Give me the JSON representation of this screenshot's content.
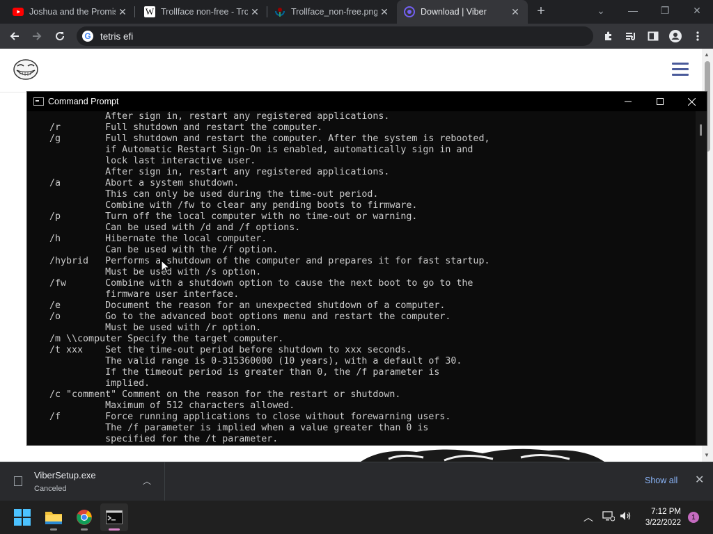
{
  "browser": {
    "tabs": [
      {
        "title": "Joshua and the Promis",
        "favicon": "youtube-icon",
        "active": false
      },
      {
        "title": "Trollface non-free - Tro",
        "favicon": "wikipedia-icon",
        "active": false
      },
      {
        "title": "Trollface_non-free.png",
        "favicon": "wikimedia-icon",
        "active": false
      },
      {
        "title": "Download | Viber",
        "favicon": "viber-icon",
        "active": true
      }
    ],
    "omnibox_text": "tetris efi",
    "colors": {
      "tabstrip": "#202124",
      "toolbar": "#35363a",
      "omnibox": "#202124"
    }
  },
  "cmd": {
    "title": "Command Prompt",
    "colors": {
      "background": "#0c0c0c",
      "text": "#cccccc"
    },
    "lines": [
      "              After sign in, restart any registered applications.",
      "    /r        Full shutdown and restart the computer.",
      "    /g        Full shutdown and restart the computer. After the system is rebooted,",
      "              if Automatic Restart Sign-On is enabled, automatically sign in and",
      "              lock last interactive user.",
      "              After sign in, restart any registered applications.",
      "    /a        Abort a system shutdown.",
      "              This can only be used during the time-out period.",
      "              Combine with /fw to clear any pending boots to firmware.",
      "    /p        Turn off the local computer with no time-out or warning.",
      "              Can be used with /d and /f options.",
      "    /h        Hibernate the local computer.",
      "              Can be used with the /f option.",
      "    /hybrid   Performs a shutdown of the computer and prepares it for fast startup.",
      "              Must be used with /s option.",
      "    /fw       Combine with a shutdown option to cause the next boot to go to the",
      "              firmware user interface.",
      "    /e        Document the reason for an unexpected shutdown of a computer.",
      "    /o        Go to the advanced boot options menu and restart the computer.",
      "              Must be used with /r option.",
      "    /m \\\\computer Specify the target computer.",
      "    /t xxx    Set the time-out period before shutdown to xxx seconds.",
      "              The valid range is 0-315360000 (10 years), with a default of 30.",
      "              If the timeout period is greater than 0, the /f parameter is",
      "              implied.",
      "    /c \"comment\" Comment on the reason for the restart or shutdown.",
      "              Maximum of 512 characters allowed.",
      "    /f        Force running applications to close without forewarning users.",
      "              The /f parameter is implied when a value greater than 0 is",
      "              specified for the /t parameter."
    ]
  },
  "download": {
    "filename": "ViberSetup.exe",
    "status": "Canceled",
    "show_all": "Show all"
  },
  "taskbar": {
    "apps": [
      "start-icon",
      "file-explorer-icon",
      "chrome-icon",
      "terminal-icon"
    ],
    "time": "7:12 PM",
    "date": "3/22/2022",
    "notification_count": "1",
    "accent": "#d985c9"
  }
}
